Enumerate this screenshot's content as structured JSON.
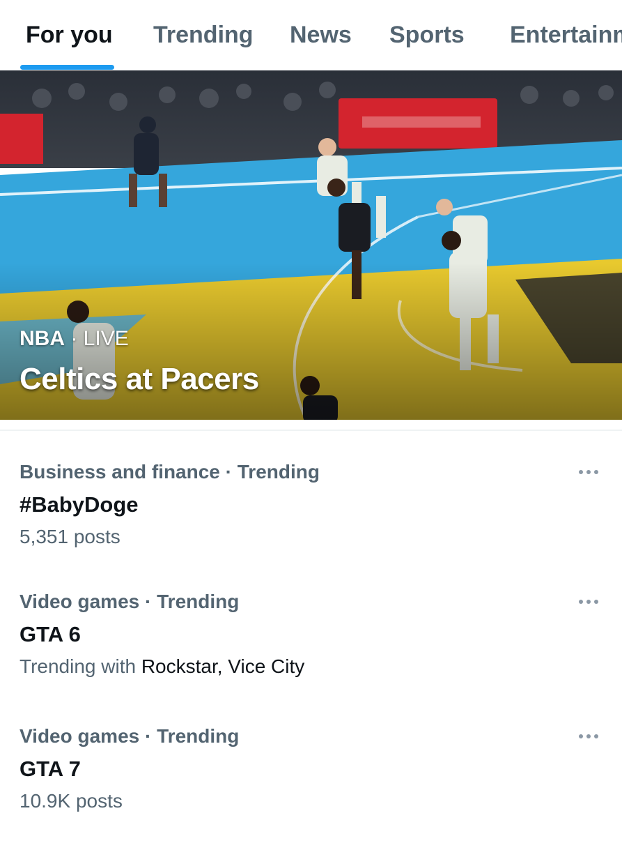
{
  "tabs": [
    {
      "label": "For you",
      "active": true
    },
    {
      "label": "Trending",
      "active": false
    },
    {
      "label": "News",
      "active": false
    },
    {
      "label": "Sports",
      "active": false
    },
    {
      "label": "Entertainment",
      "active": false
    }
  ],
  "hero": {
    "league": "NBA",
    "separator": " · ",
    "status": "LIVE",
    "title": "Celtics at Pacers"
  },
  "trends": [
    {
      "context": "Business and finance · Trending",
      "name": "#BabyDoge",
      "posts": "5,351 posts",
      "more_icon": "ellipsis-icon"
    },
    {
      "context": "Video games · Trending",
      "name": "GTA 6",
      "trending_with_label": "Trending with",
      "trending_with_names": "Rockstar, Vice City",
      "more_icon": "ellipsis-icon"
    },
    {
      "context": "Video games · Trending",
      "name": "GTA 7",
      "posts": "10.9K posts",
      "more_icon": "ellipsis-icon"
    }
  ],
  "colors": {
    "accent": "#1d9bf0",
    "text_primary": "#0f1419",
    "text_secondary": "#536471",
    "court_blue": "#35a6dc",
    "court_yellow": "#e8c92e"
  }
}
